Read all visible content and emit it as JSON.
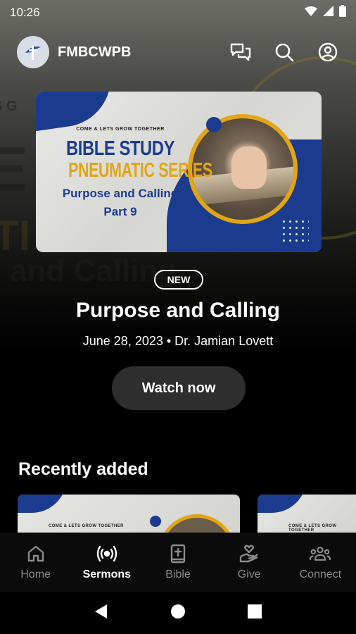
{
  "status_bar": {
    "time": "10:26",
    "icons": [
      "wifi-icon",
      "signal-icon",
      "battery-icon"
    ]
  },
  "header": {
    "app_name": "FMBCWPB",
    "icons": [
      "chat-icon",
      "search-icon",
      "profile-icon"
    ]
  },
  "featured": {
    "card": {
      "kicker": "COME & LETS GROW TOGETHER",
      "line1": "BIBLE STUDY",
      "line2": "PNEUMATIC SERIES",
      "line3": "Purpose and Calling",
      "line4": "Part 9"
    },
    "badge": "NEW",
    "title": "Purpose and Calling",
    "meta": "June 28, 2023 • Dr. Jamian Lovett",
    "cta": "Watch now"
  },
  "recently_added": {
    "title": "Recently added",
    "items": [
      {
        "kicker": "COME & LETS GROW TOGETHER"
      },
      {
        "kicker": "COME & LETS GROW TOGETHER"
      }
    ]
  },
  "bottom_nav": [
    {
      "label": "Home",
      "icon": "home-icon",
      "active": false
    },
    {
      "label": "Sermons",
      "icon": "broadcast-icon",
      "active": true
    },
    {
      "label": "Bible",
      "icon": "bible-icon",
      "active": false
    },
    {
      "label": "Give",
      "icon": "give-icon",
      "active": false
    },
    {
      "label": "Connect",
      "icon": "people-icon",
      "active": false
    }
  ],
  "colors": {
    "navy": "#1b3c8e",
    "gold": "#e2a515",
    "button": "#2e2e2e"
  }
}
